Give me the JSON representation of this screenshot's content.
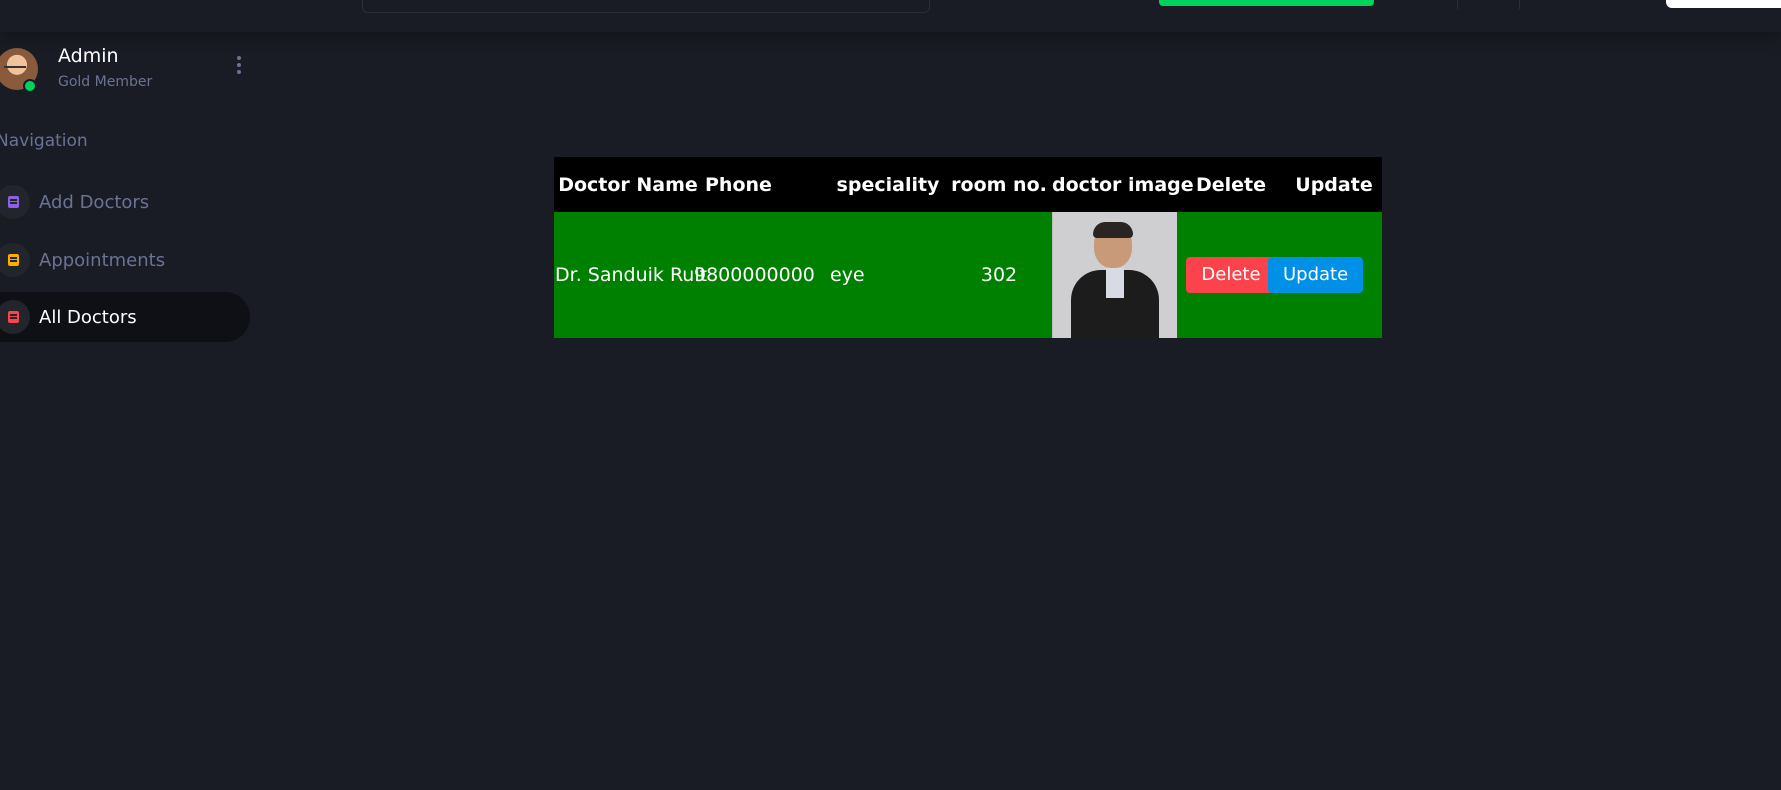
{
  "colors": {
    "background": "#191c24",
    "sidebar_active": "#0f1015",
    "table_header": "#000000",
    "table_row": "#008000",
    "delete": "#fc424a",
    "update": "#0090e7",
    "online": "#00d25b",
    "muted_text": "#6c7293"
  },
  "user": {
    "name": "Admin",
    "level": "Gold Member"
  },
  "sidebar": {
    "heading": "Navigation",
    "items": [
      {
        "label": "Add Doctors",
        "icon": "document-icon",
        "icon_color": "#8f5fe8",
        "active": false
      },
      {
        "label": "Appointments",
        "icon": "document-icon",
        "icon_color": "#ffab00",
        "active": false
      },
      {
        "label": "All Doctors",
        "icon": "document-icon",
        "icon_color": "#fc424a",
        "active": true
      }
    ]
  },
  "table": {
    "headers": [
      "Doctor Name",
      "Phone",
      "speciality",
      "room no.",
      "doctor image",
      "Delete",
      "Update"
    ],
    "rows": [
      {
        "name": "Dr. Sanduik Ruit",
        "phone": "9800000000",
        "speciality": "eye",
        "room": "302",
        "delete_label": "Delete",
        "update_label": "Update"
      }
    ]
  }
}
